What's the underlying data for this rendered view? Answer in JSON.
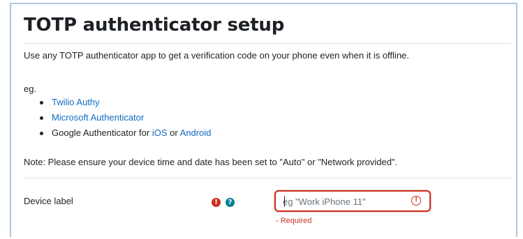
{
  "page": {
    "title": "TOTP authenticator setup",
    "intro": "Use any TOTP authenticator app to get a verification code on your phone even when it is offline.",
    "eg_label": "eg.",
    "apps": {
      "twilio": "Twilio Authy",
      "microsoft": "Microsoft Authenticator",
      "google_prefix": "Google Authenticator for ",
      "google_ios": "iOS",
      "google_or": " or ",
      "google_android": "Android"
    },
    "note": "Note: Please ensure your device time and date has been set to \"Auto\" or \"Network provided\"."
  },
  "form": {
    "device_label": {
      "label": "Device label",
      "required_icon": "exclamation-circle-icon",
      "help_icon": "question-circle-icon",
      "value": "",
      "placeholder": "eg \"Work iPhone 11\"",
      "error_icon": "exclamation-circle-outline-icon",
      "error_text": "- Required"
    }
  },
  "colors": {
    "link": "#0f6cbf",
    "error": "#ca3120",
    "help": "#008196",
    "frame_border": "#aec6e4"
  }
}
